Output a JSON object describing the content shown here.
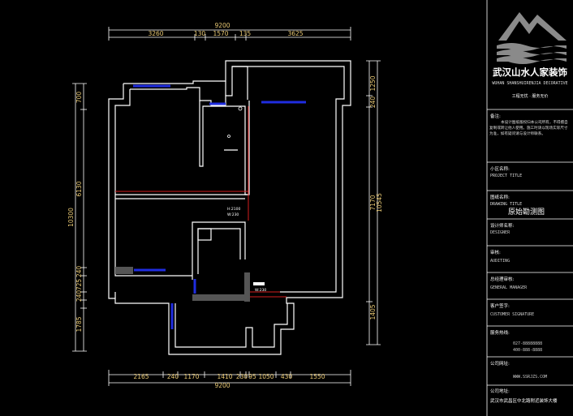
{
  "top_dims": {
    "total": "9200",
    "segments": [
      "3260",
      "130",
      "1570",
      "135",
      "3625"
    ]
  },
  "bottom_dims": {
    "total": "9200",
    "segments": [
      "2165",
      "240",
      "1170",
      "1410",
      "230",
      "95",
      "1050",
      "430",
      "1550"
    ]
  },
  "left_dims": {
    "total": "10300",
    "segments": [
      "700",
      "6130",
      "240",
      "725",
      "240",
      "240",
      "1785"
    ]
  },
  "right_dims": {
    "total": "10545",
    "segments": [
      "1250",
      "240",
      "7170",
      "1405"
    ]
  },
  "plan_labels": {
    "door_h": "H:2100",
    "door_w": "W:230",
    "win_w": "W:230"
  },
  "title_block": {
    "company_name": "武汉山水人家装饰",
    "company_name_en": "WUHAN SHANSHUIRENJIA DECORATIVE",
    "slogan": "工程无忧 · 服务无价",
    "note_label": "备注:",
    "note_text": "本设计图纸版权归本公司所有，不得擅自复制或转让他人使用。施工时请以现场实际尺寸为准，如有疑问请与设计师联系。",
    "project_label": "小区名称:",
    "project_label_en": "PROJECT TITLE",
    "drawing_label": "图纸名称:",
    "drawing_label_en": "DRAWING TITLE",
    "drawing_title": "原始勘测图",
    "designer_label": "设计师名称:",
    "designer_value": "DESIGNER",
    "drawing_scale_label": "审核:",
    "drawing_scale_value": "AUDITING",
    "manager_label": "总经理审核:",
    "manager_value": "GENERAL MANAGER",
    "client_label": "客户签字:",
    "client_value": "CUSTOMER SIGNATURE",
    "phone_label": "服务热线:",
    "phone_1": "027-88888888",
    "phone_2": "400-888-8888",
    "web_label": "公司网址:",
    "web_value": "WWW.SSRJZS.COM",
    "address_label": "公司地址:",
    "address_value": "武汉市武昌区中北路附近装饰大楼"
  }
}
